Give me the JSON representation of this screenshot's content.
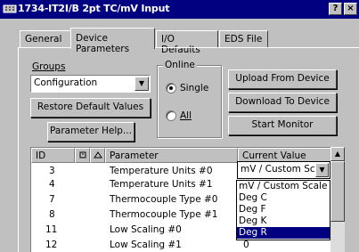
{
  "window": {
    "title": "1734-IT2I/B 2pt TC/mV Input",
    "help_glyph": "?",
    "close_glyph": "×"
  },
  "tabs": [
    {
      "label": "General"
    },
    {
      "label": "Device Parameters"
    },
    {
      "label": "I/O Defaults"
    },
    {
      "label": "EDS File"
    }
  ],
  "groups": {
    "label": "Groups",
    "selected": "Configuration",
    "arrow": "▼",
    "restore_button": "Restore Default Values",
    "help_button": "Parameter Help..."
  },
  "online": {
    "label": "Online",
    "options": [
      {
        "label": "Single",
        "selected": true
      },
      {
        "label": "All",
        "selected": false
      }
    ],
    "upload_button": "Upload From Device",
    "download_button": "Download To Device",
    "monitor_button": "Start Monitor"
  },
  "table": {
    "headers": {
      "id": "ID",
      "parameter": "Parameter",
      "value": "Current Value"
    },
    "rows": [
      {
        "id": "3",
        "parameter": "Temperature Units #0",
        "value": "mV / Custom Sca"
      },
      {
        "id": "4",
        "parameter": "Temperature Units #1",
        "value": ""
      },
      {
        "id": "7",
        "parameter": "Thermocouple Type #0",
        "value": ""
      },
      {
        "id": "8",
        "parameter": "Thermocouple Type #1",
        "value": ""
      },
      {
        "id": "11",
        "parameter": "Low Scaling #0",
        "value": ""
      },
      {
        "id": "12",
        "parameter": "Low Scaling #1",
        "value": "0"
      }
    ],
    "active_value": "mV / Custom Sca",
    "dropdown_options": [
      "mV / Custom Scale",
      "Deg C",
      "Deg F",
      "Deg K",
      "Deg R"
    ],
    "dropdown_highlighted": "Deg R",
    "scroll_up_glyph": "▲",
    "combo_arrow": "▼"
  }
}
